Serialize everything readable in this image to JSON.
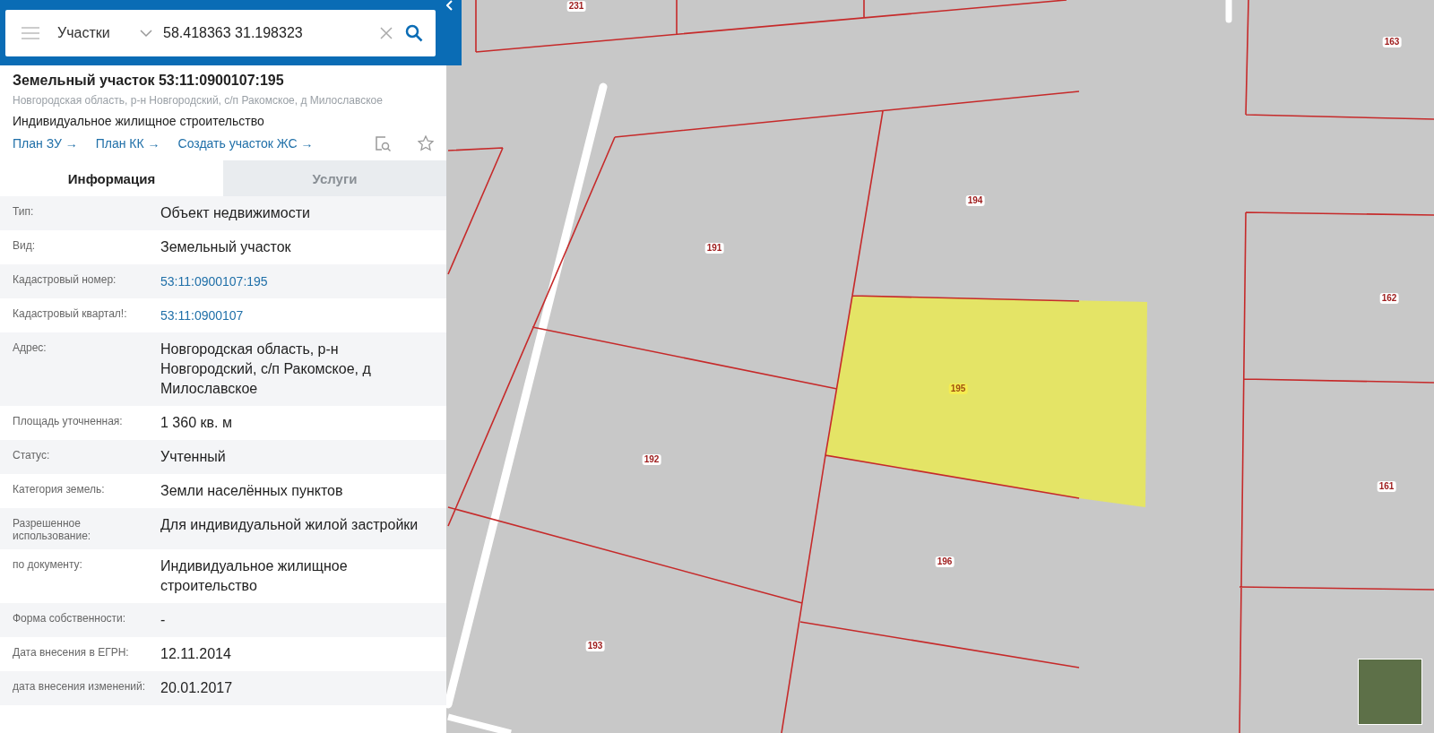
{
  "search": {
    "category": "Участки",
    "query": "58.418363 31.198323"
  },
  "object": {
    "title": "Земельный участок 53:11:0900107:195",
    "address": "Новгородская область, р-н Новгородский, с/п Ракомское, д Милославское",
    "purpose": "Индивидуальное жилищное строительство",
    "links": [
      "План ЗУ →",
      "План КК →",
      "Создать участок ЖС →"
    ]
  },
  "tabs": [
    {
      "label": "Информация",
      "selected": true
    },
    {
      "label": "Услуги",
      "selected": false
    }
  ],
  "fields": [
    {
      "label": "Тип:",
      "value": "Объект недвижимости",
      "kind": "text"
    },
    {
      "label": "Вид:",
      "value": "Земельный участок",
      "kind": "text"
    },
    {
      "label": "Кадастровый номер:",
      "value": "53:11:0900107:195",
      "kind": "link"
    },
    {
      "label": "Кадастровый квартал!:",
      "value": "53:11:0900107",
      "kind": "link"
    },
    {
      "label": "Адрес:",
      "value": "Новгородская область, р-н Новгородский, с/п Ракомское, д Милославское",
      "kind": "text"
    },
    {
      "label": "Площадь уточненная:",
      "value": "1 360 кв. м",
      "kind": "text"
    },
    {
      "label": "Статус:",
      "value": "Учтенный",
      "kind": "text"
    },
    {
      "label": "Категория земель:",
      "value": "Земли населённых пунктов",
      "kind": "text"
    },
    {
      "label": "Разрешенное использование:",
      "value": "Для индивидуальной жилой застройки",
      "kind": "text"
    },
    {
      "label": "по документу:",
      "value": "Индивидуальное жилищное строительство",
      "kind": "text"
    },
    {
      "label": "Форма собственности:",
      "value": "-",
      "kind": "text"
    },
    {
      "label": "Дата внесения в ЕГРН:",
      "value": "12.11.2014",
      "kind": "text"
    },
    {
      "label": "дата внесения изменений:",
      "value": "20.01.2017",
      "kind": "text"
    }
  ],
  "map": {
    "parcels": [
      {
        "number": "231",
        "selected": false
      },
      {
        "number": "163",
        "selected": false
      },
      {
        "number": "194",
        "selected": false
      },
      {
        "number": "191",
        "selected": false
      },
      {
        "number": "162",
        "selected": false
      },
      {
        "number": "195",
        "selected": true
      },
      {
        "number": "192",
        "selected": false
      },
      {
        "number": "161",
        "selected": false
      },
      {
        "number": "196",
        "selected": false
      },
      {
        "number": "193",
        "selected": false
      }
    ]
  }
}
